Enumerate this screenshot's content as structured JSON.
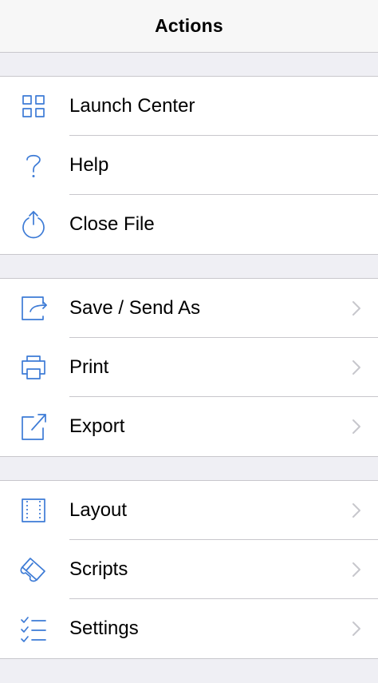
{
  "header": {
    "title": "Actions"
  },
  "groups": [
    {
      "items": [
        {
          "label": "Launch Center",
          "icon": "grid-icon",
          "chevron": false
        },
        {
          "label": "Help",
          "icon": "question-icon",
          "chevron": false
        },
        {
          "label": "Close File",
          "icon": "power-icon",
          "chevron": false
        }
      ]
    },
    {
      "items": [
        {
          "label": "Save / Send As",
          "icon": "save-send-icon",
          "chevron": true
        },
        {
          "label": "Print",
          "icon": "printer-icon",
          "chevron": true
        },
        {
          "label": "Export",
          "icon": "export-icon",
          "chevron": true
        }
      ]
    },
    {
      "items": [
        {
          "label": "Layout",
          "icon": "layout-icon",
          "chevron": true
        },
        {
          "label": "Scripts",
          "icon": "scroll-icon",
          "chevron": true
        },
        {
          "label": "Settings",
          "icon": "checklist-icon",
          "chevron": true
        }
      ]
    }
  ],
  "colors": {
    "accent": "#3d7bd6",
    "chevron": "#c7c7cc",
    "background": "#efeff4",
    "separator": "#c8c7cc"
  }
}
